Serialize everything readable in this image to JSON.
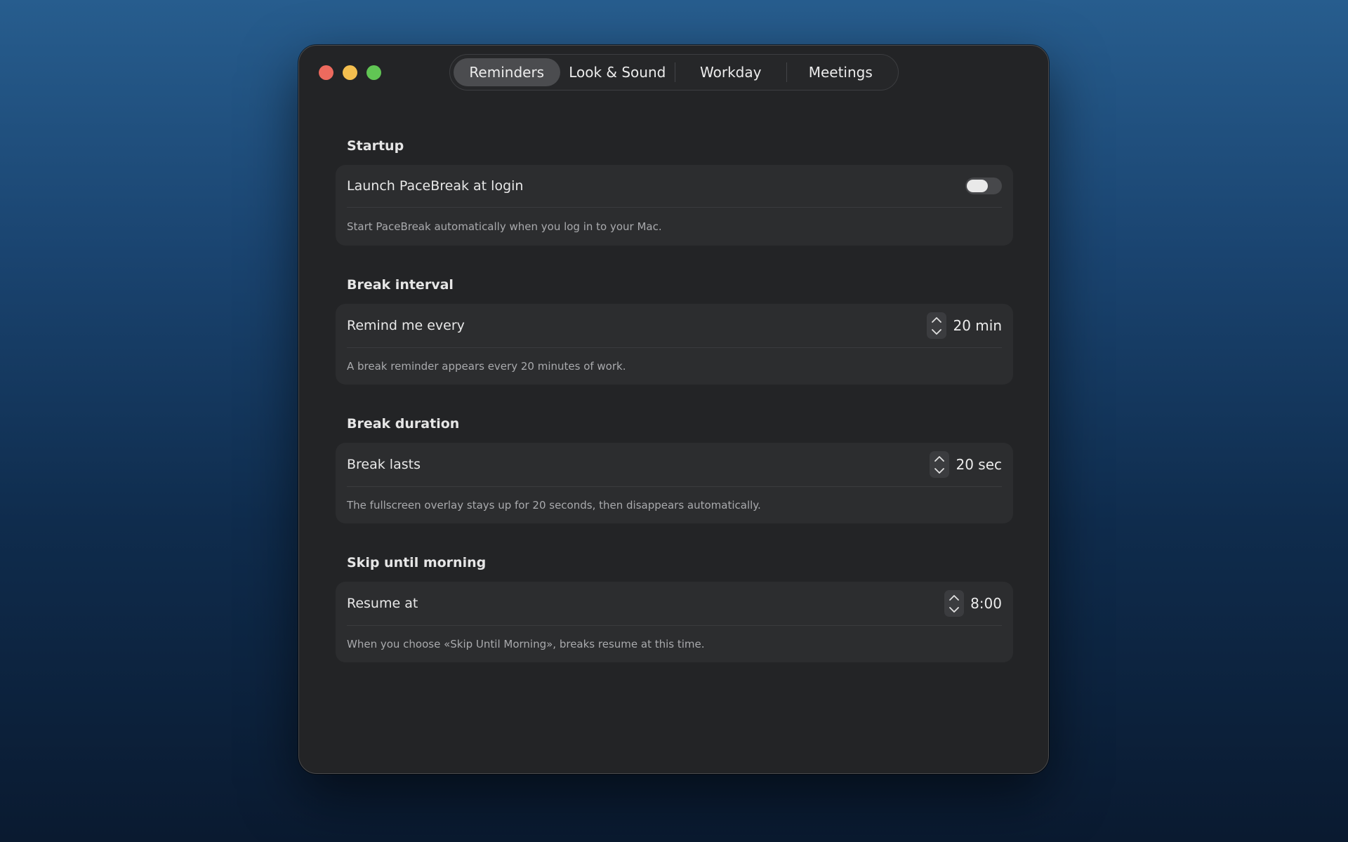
{
  "tabs": [
    {
      "label": "Reminders",
      "active": true
    },
    {
      "label": "Look & Sound",
      "active": false
    },
    {
      "label": "Workday",
      "active": false
    },
    {
      "label": "Meetings",
      "active": false
    }
  ],
  "sections": {
    "startup": {
      "title": "Startup",
      "row_label": "Launch PaceBreak at login",
      "toggle_on": false,
      "description": "Start PaceBreak automatically when you log in to your Mac."
    },
    "interval": {
      "title": "Break interval",
      "row_label": "Remind me every",
      "value": "20 min",
      "description": "A break reminder appears every 20 minutes of work."
    },
    "duration": {
      "title": "Break duration",
      "row_label": "Break lasts",
      "value": "20 sec",
      "description": "The fullscreen overlay stays up for 20 seconds, then disappears automatically."
    },
    "skip": {
      "title": "Skip until morning",
      "row_label": "Resume at",
      "value": "8:00",
      "description": "When you choose «Skip Until Morning», breaks resume at this time."
    }
  },
  "colors": {
    "close": "#ed6a5e",
    "minimize": "#f4bf4f",
    "maximize": "#61c554"
  }
}
